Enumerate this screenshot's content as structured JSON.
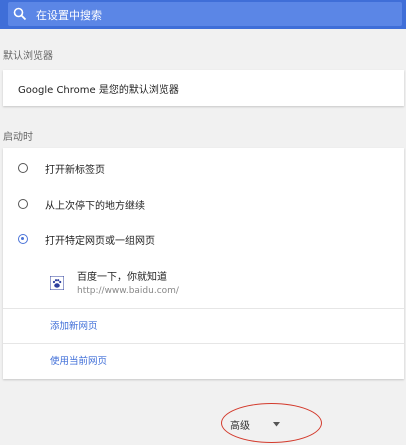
{
  "search": {
    "placeholder": "在设置中搜索"
  },
  "default_browser": {
    "section_label": "默认浏览器",
    "status_text": "Google Chrome 是您的默认浏览器"
  },
  "startup": {
    "section_label": "启动时",
    "options": [
      {
        "label": "打开新标签页",
        "checked": false
      },
      {
        "label": "从上次停下的地方继续",
        "checked": false
      },
      {
        "label": "打开特定网页或一组网页",
        "checked": true
      }
    ],
    "page": {
      "title": "百度一下，你就知道",
      "url": "http://www.baidu.com/",
      "icon": "baidu-paw-icon"
    },
    "add_page_label": "添加新网页",
    "use_current_label": "使用当前网页"
  },
  "advanced": {
    "label": "高级",
    "icon": "chevron-down-icon"
  },
  "colors": {
    "header": "#3f6ed8",
    "accent": "#4a73d8",
    "annotation": "#d33a2c"
  }
}
